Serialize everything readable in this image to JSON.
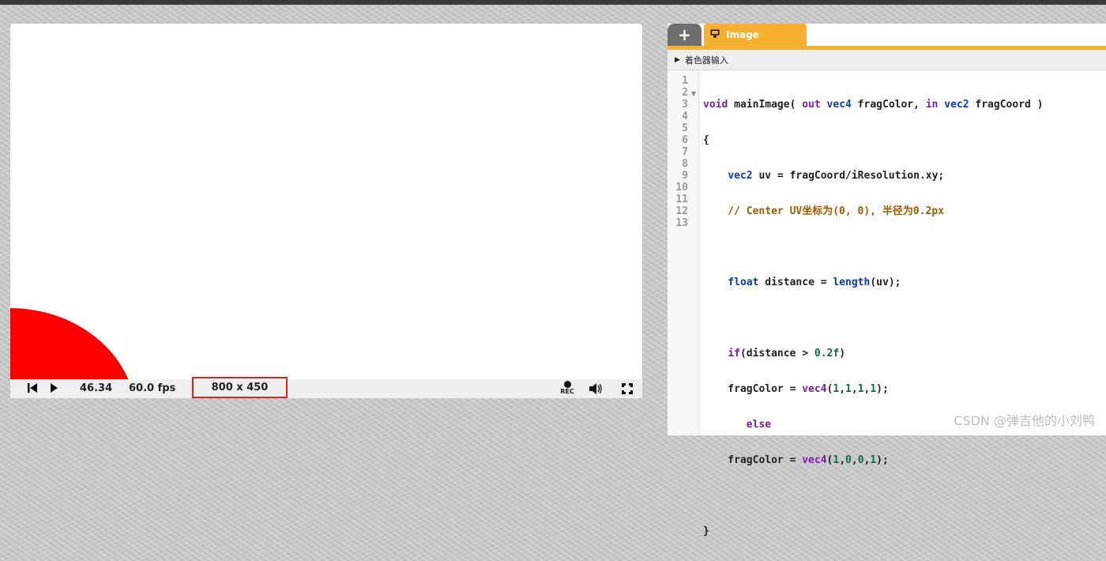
{
  "player": {
    "time": "46.34",
    "fps": "60.0 fps",
    "resolution": "800 x 450",
    "rec_label": "REC"
  },
  "editor": {
    "tab_add": "+",
    "tab_image": "Image",
    "shader_inputs": "着色器输入",
    "line_numbers": [
      "1",
      "2",
      "3",
      "4",
      "5",
      "6",
      "7",
      "8",
      "9",
      "10",
      "11",
      "12",
      "13"
    ]
  },
  "watermark": "CSDN @弹吉他的小刘鸭",
  "colors": {
    "accent": "#f7b030",
    "shape": "#ff0000",
    "highlight_border": "#e02020"
  }
}
